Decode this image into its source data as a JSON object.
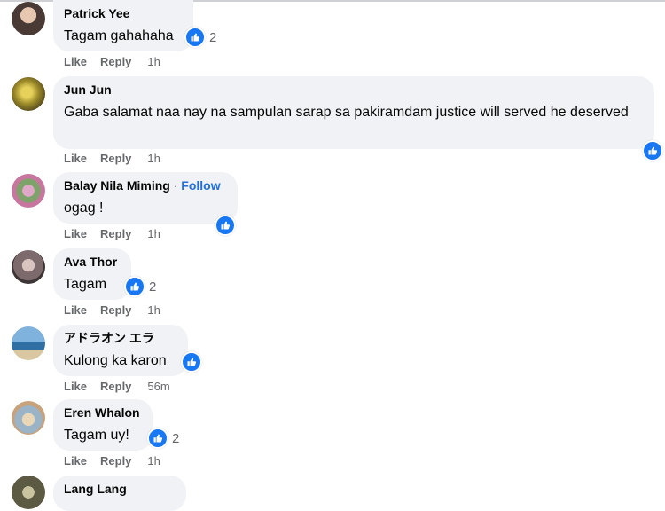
{
  "comments": [
    {
      "author": "Patrick Yee",
      "text": "Tagam gahahaha",
      "reactions": "2",
      "time": "1h",
      "like": "Like",
      "reply": "Reply",
      "avatar_color": "#7a5c4a"
    },
    {
      "author": "Jun Jun",
      "text": "Gaba salamat naa nay na sampulan sarap sa pakiramdam justice will served he deserved",
      "reactions": "",
      "time": "1h",
      "like": "Like",
      "reply": "Reply",
      "avatar_color": "#c9a93a"
    },
    {
      "author": "Balay Nila Miming",
      "separator": "·",
      "follow": "Follow",
      "text": "ogag !",
      "reactions": "",
      "time": "1h",
      "like": "Like",
      "reply": "Reply",
      "avatar_color": "#b07aa1"
    },
    {
      "author": "Ava Thor",
      "text": "Tagam",
      "reactions": "2",
      "time": "1h",
      "like": "Like",
      "reply": "Reply",
      "avatar_color": "#8d7e80"
    },
    {
      "author": "アドラオン エラ",
      "text": "Kulong ka karon",
      "reactions": "",
      "time": "56m",
      "like": "Like",
      "reply": "Reply",
      "avatar_color": "#4f8fc0"
    },
    {
      "author": "Eren Whalon",
      "text": "Tagam uy!",
      "reactions": "2",
      "time": "1h",
      "like": "Like",
      "reply": "Reply",
      "avatar_color": "#c8b48f"
    },
    {
      "author": "Lang Lang",
      "avatar_color": "#5d5a44"
    }
  ],
  "colors": {
    "like_blue": "#1877f2",
    "follow_blue": "#216fdb",
    "bubble": "#f0f2f5",
    "meta": "#65676b"
  }
}
